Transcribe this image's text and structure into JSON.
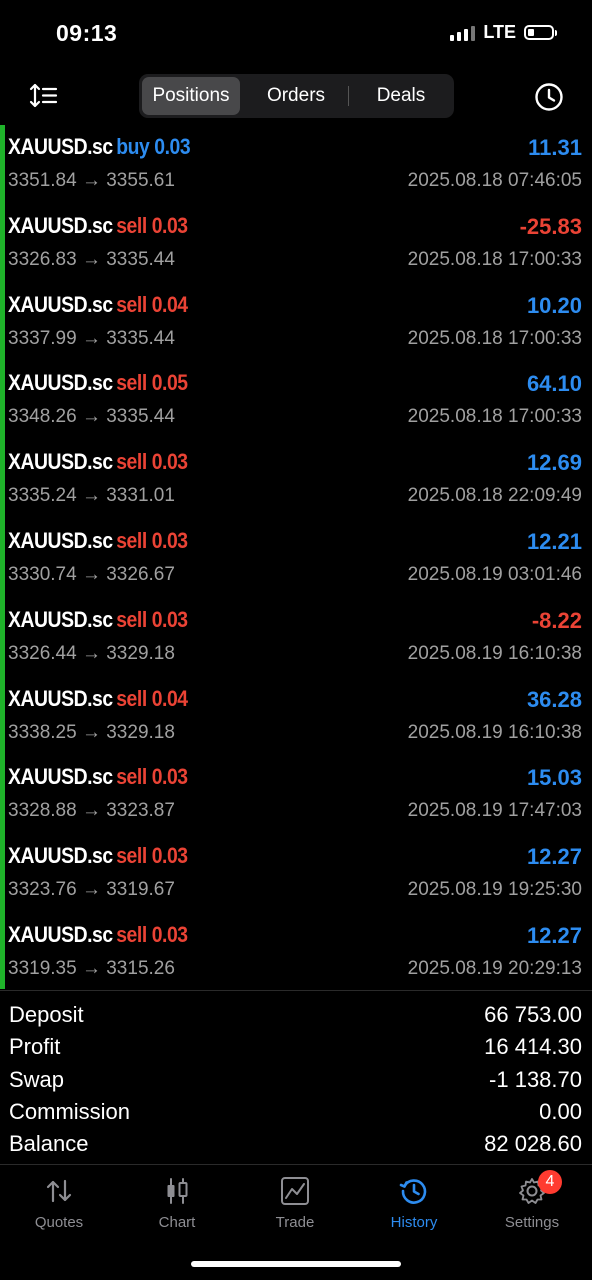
{
  "status": {
    "time": "09:13",
    "network": "LTE"
  },
  "tabs": {
    "positions": "Positions",
    "orders": "Orders",
    "deals": "Deals"
  },
  "deals": [
    {
      "symbol": "XAUUSD.sc",
      "direction": "buy 0.03",
      "profit": "11.31",
      "prices": "3351.84 → 3355.61",
      "time": "2025.08.18 07:46:05"
    },
    {
      "symbol": "XAUUSD.sc",
      "direction": "sell 0.03",
      "profit": "-25.83",
      "prices": "3326.83 → 3335.44",
      "time": "2025.08.18 17:00:33"
    },
    {
      "symbol": "XAUUSD.sc",
      "direction": "sell 0.04",
      "profit": "10.20",
      "prices": "3337.99 → 3335.44",
      "time": "2025.08.18 17:00:33"
    },
    {
      "symbol": "XAUUSD.sc",
      "direction": "sell 0.05",
      "profit": "64.10",
      "prices": "3348.26 → 3335.44",
      "time": "2025.08.18 17:00:33"
    },
    {
      "symbol": "XAUUSD.sc",
      "direction": "sell 0.03",
      "profit": "12.69",
      "prices": "3335.24 → 3331.01",
      "time": "2025.08.18 22:09:49"
    },
    {
      "symbol": "XAUUSD.sc",
      "direction": "sell 0.03",
      "profit": "12.21",
      "prices": "3330.74 → 3326.67",
      "time": "2025.08.19 03:01:46"
    },
    {
      "symbol": "XAUUSD.sc",
      "direction": "sell 0.03",
      "profit": "-8.22",
      "prices": "3326.44 → 3329.18",
      "time": "2025.08.19 16:10:38"
    },
    {
      "symbol": "XAUUSD.sc",
      "direction": "sell 0.04",
      "profit": "36.28",
      "prices": "3338.25 → 3329.18",
      "time": "2025.08.19 16:10:38"
    },
    {
      "symbol": "XAUUSD.sc",
      "direction": "sell 0.03",
      "profit": "15.03",
      "prices": "3328.88 → 3323.87",
      "time": "2025.08.19 17:47:03"
    },
    {
      "symbol": "XAUUSD.sc",
      "direction": "sell 0.03",
      "profit": "12.27",
      "prices": "3323.76 → 3319.67",
      "time": "2025.08.19 19:25:30"
    },
    {
      "symbol": "XAUUSD.sc",
      "direction": "sell 0.03",
      "profit": "12.27",
      "prices": "3319.35 → 3315.26",
      "time": "2025.08.19 20:29:13"
    }
  ],
  "summary": [
    {
      "label": "Deposit",
      "value": "66 753.00"
    },
    {
      "label": "Profit",
      "value": "16 414.30"
    },
    {
      "label": "Swap",
      "value": "-1 138.70"
    },
    {
      "label": "Commission",
      "value": "0.00"
    },
    {
      "label": "Balance",
      "value": "82 028.60"
    }
  ],
  "tabbar": {
    "quotes": "Quotes",
    "chart": "Chart",
    "trade": "Trade",
    "history": "History",
    "settings": "Settings",
    "settings_badge": "4"
  },
  "colors": {
    "buy": "#2d8cf0",
    "sell": "#ea4335",
    "accent": "#2d8cf0",
    "green_marker": "#1fb32a"
  },
  "icons": {
    "sort": "sort-icon",
    "clock": "history-clock-icon"
  }
}
